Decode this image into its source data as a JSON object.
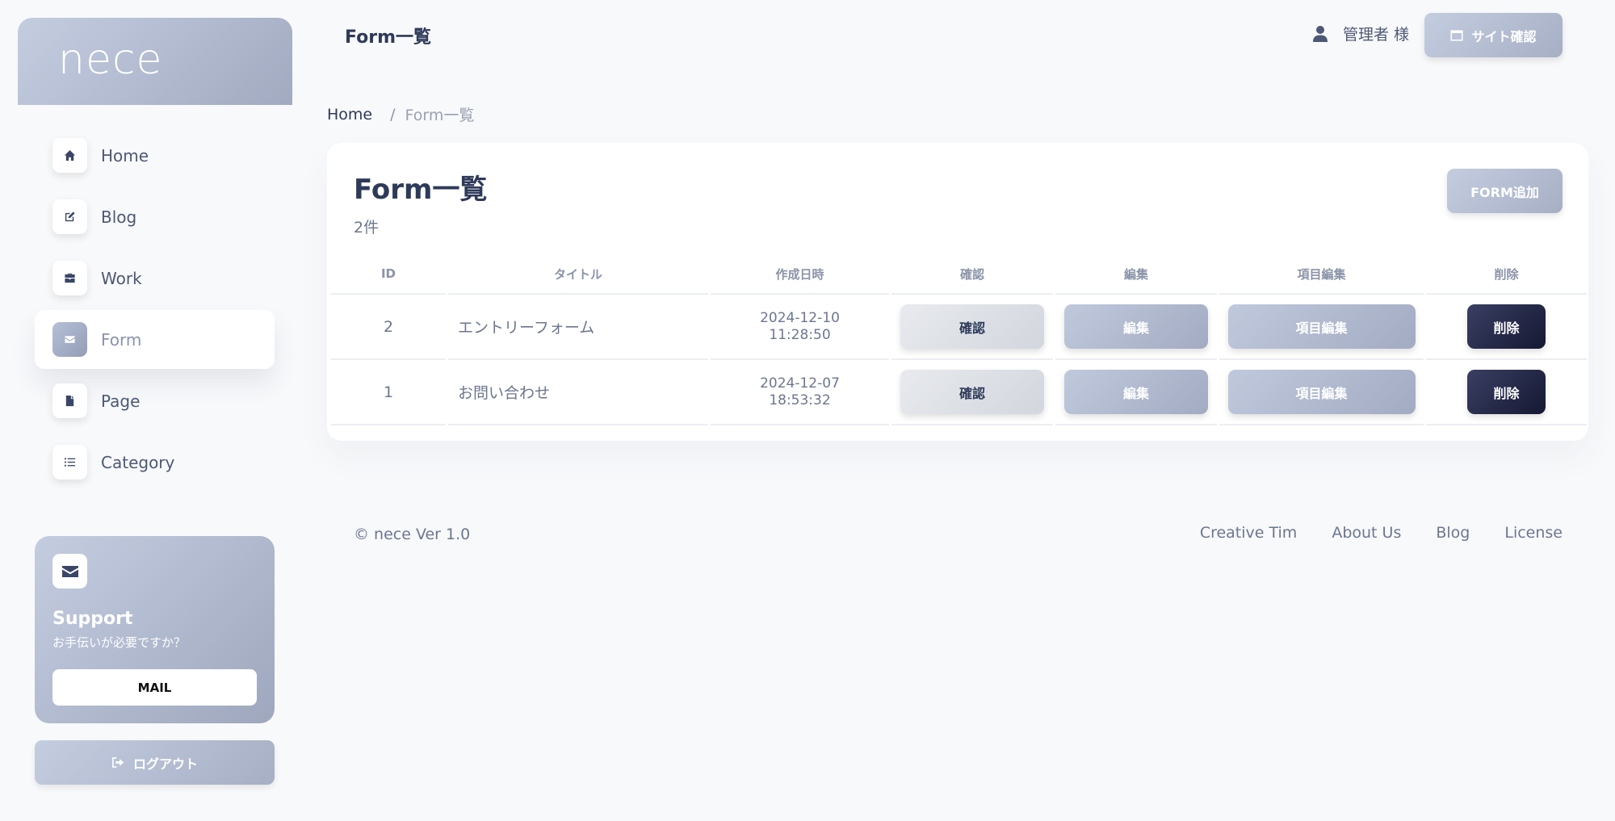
{
  "brand": {
    "name": "nece"
  },
  "sidebar": {
    "items": [
      {
        "label": "Home",
        "icon": "home-icon"
      },
      {
        "label": "Blog",
        "icon": "edit-icon"
      },
      {
        "label": "Work",
        "icon": "briefcase-icon"
      },
      {
        "label": "Form",
        "icon": "envelope-icon",
        "active": true
      },
      {
        "label": "Page",
        "icon": "file-icon"
      },
      {
        "label": "Category",
        "icon": "list-icon"
      }
    ],
    "support": {
      "title": "Support",
      "subtitle": "お手伝いが必要ですか？",
      "button": "MAIL"
    },
    "logout": "ログアウト"
  },
  "header": {
    "title": "Form一覧",
    "user": "管理者 様",
    "site_button": "サイト確認"
  },
  "breadcrumb": {
    "home": "Home",
    "separator": "/",
    "current": "Form一覧"
  },
  "card": {
    "title": "Form一覧",
    "count": "2件",
    "add_button": "FORM追加",
    "columns": [
      "ID",
      "タイトル",
      "作成日時",
      "確認",
      "編集",
      "項目編集",
      "削除"
    ],
    "rows": [
      {
        "id": "2",
        "title": "エントリーフォーム",
        "date": "2024-12-10",
        "time": "11:28:50",
        "confirm": "確認",
        "edit": "編集",
        "item_edit": "項目編集",
        "delete": "削除"
      },
      {
        "id": "1",
        "title": "お問い合わせ",
        "date": "2024-12-07",
        "time": "18:53:32",
        "confirm": "確認",
        "edit": "編集",
        "item_edit": "項目編集",
        "delete": "削除"
      }
    ]
  },
  "footer": {
    "copyright": "© nece Ver 1.0",
    "links": [
      "Creative Tim",
      "About Us",
      "Blog",
      "License"
    ]
  },
  "colors": {
    "accent_gradient_start": "#c4cde0",
    "accent_gradient_end": "#a1aac0",
    "delete_button": "#1e2240",
    "text_primary": "#2e3a59"
  }
}
